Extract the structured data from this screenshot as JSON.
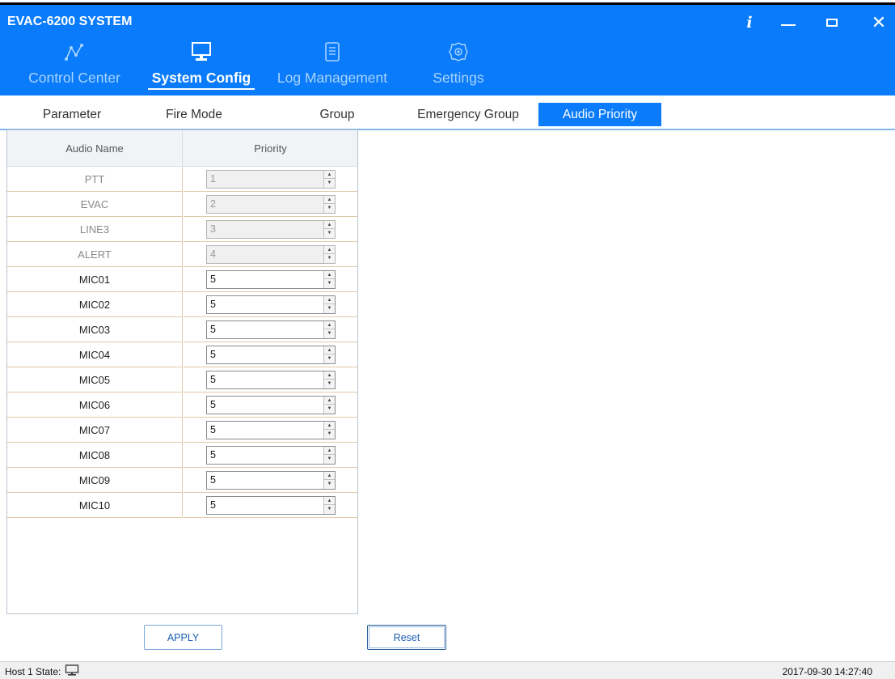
{
  "window": {
    "title": "EVAC-6200 SYSTEM",
    "info_glyph": "i",
    "controls": [
      "minimize-icon",
      "maximize-icon",
      "close-icon"
    ]
  },
  "colors": {
    "titlebar": "#0a7bfa",
    "active_tab": "#0a7bfa",
    "row_border": "#e0c9a8"
  },
  "nav": {
    "items": [
      {
        "label": "Control Center",
        "icon": "network-icon",
        "active": false
      },
      {
        "label": "System Config",
        "icon": "monitor-icon",
        "active": true
      },
      {
        "label": "Log Management",
        "icon": "document-icon",
        "active": false
      },
      {
        "label": "Settings",
        "icon": "gear-icon",
        "active": false
      }
    ]
  },
  "subtabs": {
    "items": [
      {
        "label": "Parameter",
        "active": false
      },
      {
        "label": "Fire Mode",
        "active": false
      },
      {
        "label": "Group",
        "active": false
      },
      {
        "label": "Emergency Group",
        "active": false
      },
      {
        "label": "Audio Priority",
        "active": true
      }
    ]
  },
  "table": {
    "headers": [
      "Audio Name",
      "Priority"
    ],
    "rows": [
      {
        "name": "PTT",
        "priority": "1",
        "editable": false
      },
      {
        "name": "EVAC",
        "priority": "2",
        "editable": false
      },
      {
        "name": "LINE3",
        "priority": "3",
        "editable": false
      },
      {
        "name": "ALERT",
        "priority": "4",
        "editable": false
      },
      {
        "name": "MIC01",
        "priority": "5",
        "editable": true
      },
      {
        "name": "MIC02",
        "priority": "5",
        "editable": true
      },
      {
        "name": "MIC03",
        "priority": "5",
        "editable": true
      },
      {
        "name": "MIC04",
        "priority": "5",
        "editable": true
      },
      {
        "name": "MIC05",
        "priority": "5",
        "editable": true
      },
      {
        "name": "MIC06",
        "priority": "5",
        "editable": true
      },
      {
        "name": "MIC07",
        "priority": "5",
        "editable": true
      },
      {
        "name": "MIC08",
        "priority": "5",
        "editable": true
      },
      {
        "name": "MIC09",
        "priority": "5",
        "editable": true
      },
      {
        "name": "MIC10",
        "priority": "5",
        "editable": true
      }
    ]
  },
  "buttons": {
    "apply": "APPLY",
    "reset": "Reset"
  },
  "status": {
    "host_label": "Host 1 State:",
    "host_icon": "monitor-icon",
    "datetime": "2017-09-30 14:27:40"
  }
}
